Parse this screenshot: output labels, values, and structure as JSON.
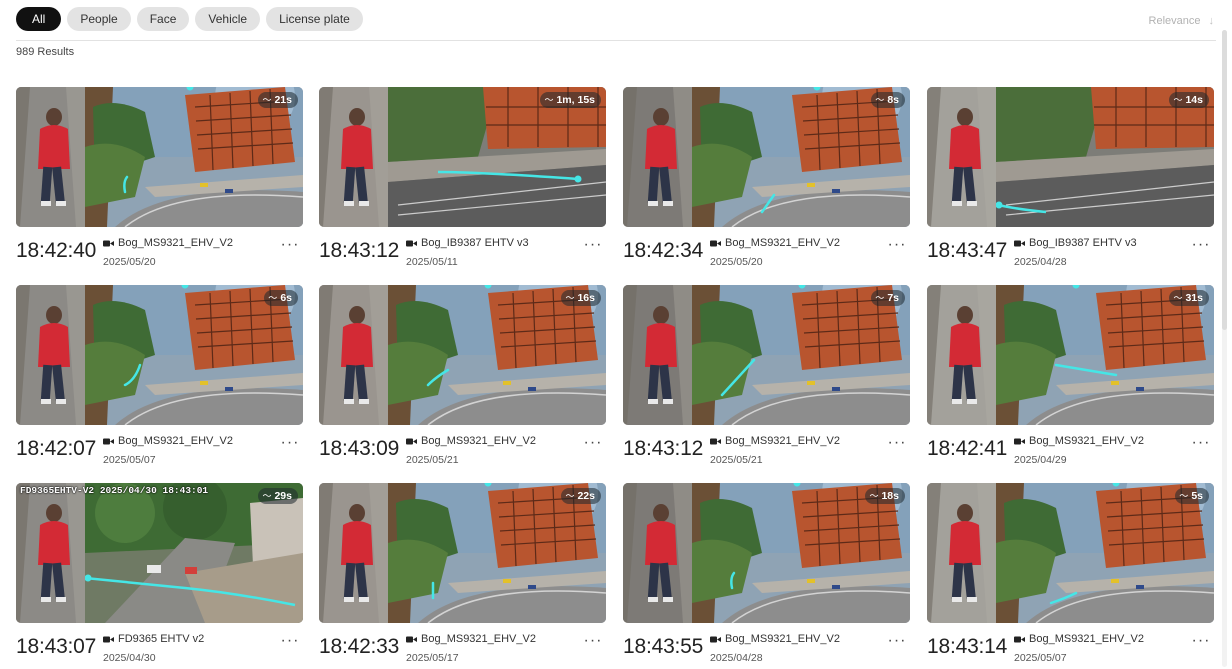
{
  "filters": [
    {
      "label": "All",
      "active": true
    },
    {
      "label": "People",
      "active": false
    },
    {
      "label": "Face",
      "active": false
    },
    {
      "label": "Vehicle",
      "active": false
    },
    {
      "label": "License plate",
      "active": false
    }
  ],
  "sort": {
    "label": "Relevance",
    "icon": "arrow-down-icon"
  },
  "results_count": "989 Results",
  "colors": {
    "chip_active_bg": "#111111",
    "chip_bg": "#e3e3e3",
    "track_line": "#45e6e6",
    "subject_red": "#d32a35",
    "building_orange": "#b8552f"
  },
  "results": [
    {
      "time": "18:42:40",
      "camera": "Bog_MS9321_EHV_V2",
      "date": "2025/05/20",
      "duration": "21s",
      "scene": "A"
    },
    {
      "time": "18:43:12",
      "camera": "Bog_IB9387 EHTV v3",
      "date": "2025/05/11",
      "duration": "1m, 15s",
      "scene": "B"
    },
    {
      "time": "18:42:34",
      "camera": "Bog_MS9321_EHV_V2",
      "date": "2025/05/20",
      "duration": "8s",
      "scene": "A"
    },
    {
      "time": "18:43:47",
      "camera": "Bog_IB9387 EHTV v3",
      "date": "2025/04/28",
      "duration": "14s",
      "scene": "B"
    },
    {
      "time": "18:42:07",
      "camera": "Bog_MS9321_EHV_V2",
      "date": "2025/05/07",
      "duration": "6s",
      "scene": "A"
    },
    {
      "time": "18:43:09",
      "camera": "Bog_MS9321_EHV_V2",
      "date": "2025/05/21",
      "duration": "16s",
      "scene": "A"
    },
    {
      "time": "18:43:12",
      "camera": "Bog_MS9321_EHV_V2",
      "date": "2025/05/21",
      "duration": "7s",
      "scene": "A"
    },
    {
      "time": "18:42:41",
      "camera": "Bog_MS9321_EHV_V2",
      "date": "2025/04/29",
      "duration": "31s",
      "scene": "A"
    },
    {
      "time": "18:43:07",
      "camera": "FD9365 EHTV v2",
      "date": "2025/04/30",
      "duration": "29s",
      "scene": "C",
      "overlay": "FD9365EHTV-V2 2025/04/30 18:43:01"
    },
    {
      "time": "18:42:33",
      "camera": "Bog_MS9321_EHV_V2",
      "date": "2025/05/17",
      "duration": "22s",
      "scene": "A"
    },
    {
      "time": "18:43:55",
      "camera": "Bog_MS9321_EHV_V2",
      "date": "2025/04/28",
      "duration": "18s",
      "scene": "A"
    },
    {
      "time": "18:43:14",
      "camera": "Bog_MS9321_EHV_V2",
      "date": "2025/05/07",
      "duration": "5s",
      "scene": "A"
    }
  ]
}
